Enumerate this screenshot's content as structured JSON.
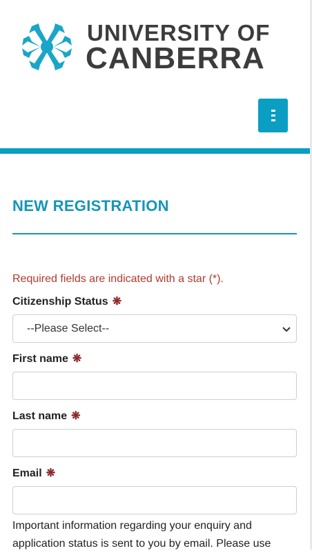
{
  "header": {
    "logo_line1": "UNIVERSITY OF",
    "logo_line2": "CANBERRA",
    "menu_icon": "hamburger-icon"
  },
  "page": {
    "title": "NEW REGISTRATION",
    "required_note": "Required fields are indicated with a star (*)."
  },
  "form": {
    "citizenship": {
      "label": "Citizenship Status",
      "selected": "--Please Select--"
    },
    "first_name": {
      "label": "First name",
      "value": ""
    },
    "last_name": {
      "label": "Last name",
      "value": ""
    },
    "email": {
      "label": "Email",
      "value": ""
    },
    "required_star": "❋",
    "info_text": "Important information regarding your enquiry and application status is sent to you by email. Please use"
  },
  "colors": {
    "accent": "#0a9ec2",
    "title": "#1596b8",
    "required_text": "#b03a2e",
    "star": "#8b2a2a"
  }
}
